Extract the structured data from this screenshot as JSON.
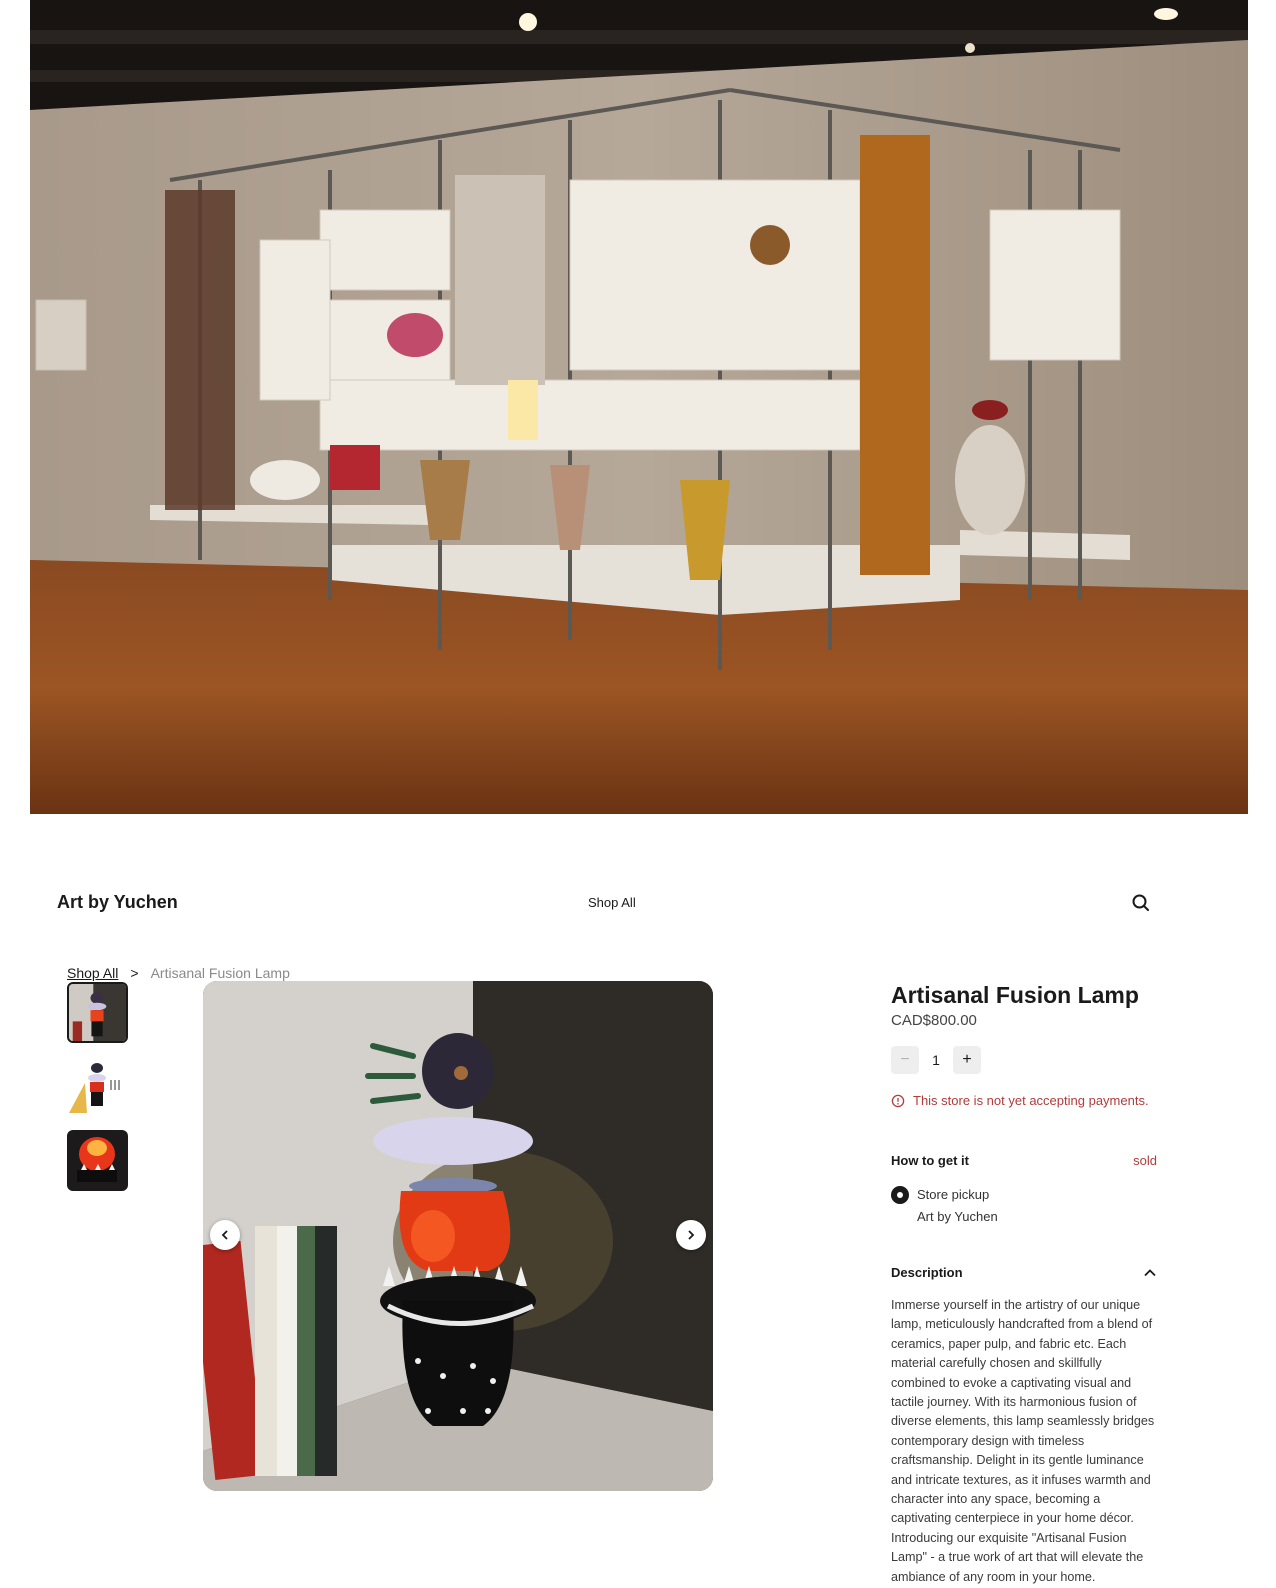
{
  "hero": {
    "alt": "Gallery interior with shelving display",
    "icon": "gallery-photo"
  },
  "header": {
    "brand": "Art by Yuchen",
    "nav_shop_all": "Shop All",
    "search_icon": "search-icon"
  },
  "breadcrumb": {
    "root": "Shop All",
    "separator": ">",
    "current": "Artisanal Fusion Lamp"
  },
  "gallery": {
    "thumbnails": [
      "thumb-1",
      "thumb-2",
      "thumb-3"
    ],
    "active_index": 0,
    "prev_icon": "chevron-left-icon",
    "next_icon": "chevron-right-icon"
  },
  "product": {
    "title": "Artisanal Fusion Lamp",
    "price": "CAD$800.00",
    "quantity": "1",
    "minus": "−",
    "plus": "+",
    "notice": "This store is not yet accepting payments.",
    "how_title": "How to get it",
    "sold": "sold",
    "pickup_label": "Store pickup",
    "pickup_location": "Art by Yuchen",
    "description_title": "Description",
    "description": "Immerse yourself in the artistry of our unique lamp, meticulously handcrafted from a blend of ceramics, paper pulp, and fabric etc. Each material carefully chosen and skillfully combined to evoke a captivating visual and tactile journey. With its harmonious fusion of diverse elements, this lamp seamlessly bridges contemporary design with timeless craftsmanship. Delight in its gentle luminance and intricate textures, as it infuses warmth and character into any space, becoming a captivating centerpiece in your home décor. Introducing our exquisite \"Artisanal Fusion Lamp\" - a true work of art that will elevate the ambiance of any room in your home."
  },
  "colors": {
    "accent": "#1a1a1a",
    "error": "#b23b3b",
    "muted": "#8a8a8a"
  }
}
